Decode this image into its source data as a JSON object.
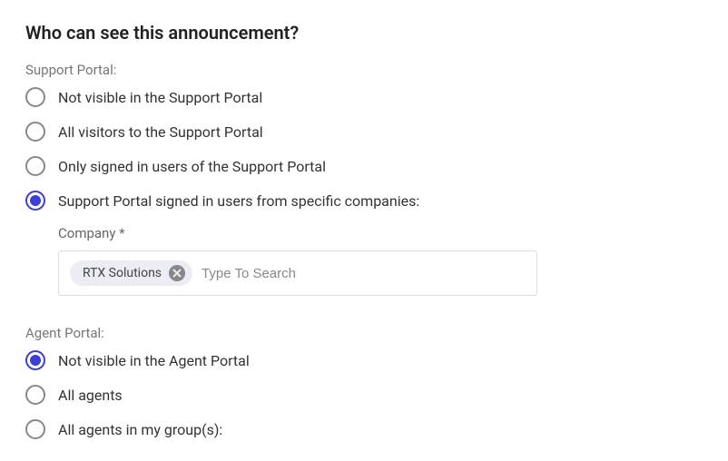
{
  "heading": "Who can see this announcement?",
  "supportPortal": {
    "label": "Support Portal:",
    "options": [
      "Not visible in the Support Portal",
      "All visitors to the Support Portal",
      "Only signed in users of the Support Portal",
      "Support Portal signed in users from specific companies:"
    ],
    "selectedIndex": 3,
    "companyLabel": "Company *",
    "companyChip": "RTX Solutions",
    "companyPlaceholder": "Type To Search"
  },
  "agentPortal": {
    "label": "Agent Portal:",
    "options": [
      "Not visible in the Agent Portal",
      "All agents",
      "All agents in my group(s):"
    ],
    "selectedIndex": 0
  }
}
